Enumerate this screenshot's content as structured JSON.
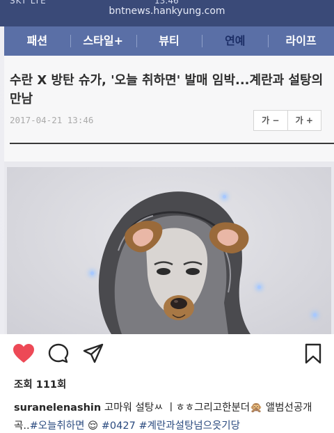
{
  "browser": {
    "status_carrier": "SKT LTE",
    "status_time": "13:46",
    "url": "bntnews.hankyung.com"
  },
  "nav": {
    "items": [
      {
        "label": "패션",
        "active": false
      },
      {
        "label": "스타일+",
        "active": false
      },
      {
        "label": "뷰티",
        "active": false
      },
      {
        "label": "연예",
        "active": true
      },
      {
        "label": "라이프",
        "active": false
      }
    ]
  },
  "article": {
    "headline": "수란 X 방탄 슈가, '오늘 취하면' 발매 임박...계란과 설탕의 만남",
    "date": "2017-04-21 13:46",
    "font_minus": "가 −",
    "font_plus": "가 +"
  },
  "post": {
    "likes_text": "조회 111회",
    "username": "suranelenashin",
    "caption_text": " 고마워 설탕ㅆ ㅣㅎㅎ그리고한분더🙊 앨범선공개곡..",
    "tags": [
      "#오늘취하면",
      "😌",
      "#0427",
      "#계란과설탕넘으읏기당"
    ]
  },
  "colors": {
    "browser_bar": "#3a4a78",
    "nav_bar": "#5a6fa6",
    "like_heart": "#ed4956",
    "hashtag": "#2a4a7f"
  },
  "icons": [
    "heart-icon",
    "comment-icon",
    "share-icon",
    "bookmark-icon"
  ]
}
